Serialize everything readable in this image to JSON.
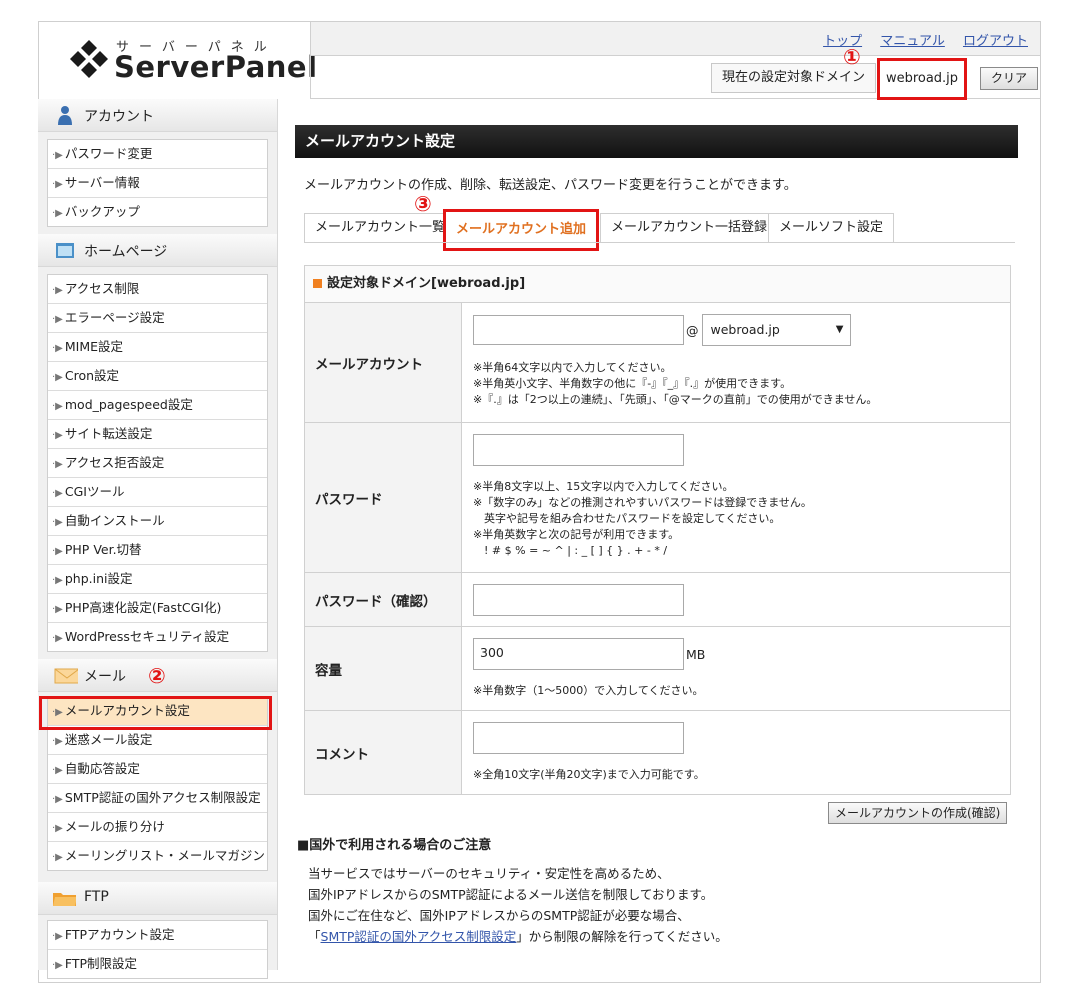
{
  "header": {
    "logo_kana": "サーバーパネル",
    "logo_text": "ServerPanel",
    "links": [
      "トップ",
      "マニュアル",
      "ログアウト"
    ],
    "current_domain_label": "現在の設定対象ドメイン",
    "current_domain_value": "webroad.jp",
    "clear_label": "クリア"
  },
  "annotations": [
    "①",
    "②",
    "③"
  ],
  "sidebar": {
    "account": {
      "title": "アカウント",
      "items": [
        "パスワード変更",
        "サーバー情報",
        "バックアップ"
      ]
    },
    "homepage": {
      "title": "ホームページ",
      "items": [
        "アクセス制限",
        "エラーページ設定",
        "MIME設定",
        "Cron設定",
        "mod_pagespeed設定",
        "サイト転送設定",
        "アクセス拒否設定",
        "CGIツール",
        "自動インストール",
        "PHP Ver.切替",
        "php.ini設定",
        "PHP高速化設定(FastCGI化)",
        "WordPressセキュリティ設定"
      ]
    },
    "mail": {
      "title": "メール",
      "items": [
        "メールアカウント設定",
        "迷惑メール設定",
        "自動応答設定",
        "SMTP認証の国外アクセス制限設定",
        "メールの振り分け",
        "メーリングリスト・メールマガジン"
      ]
    },
    "ftp": {
      "title": "FTP",
      "items": [
        "FTPアカウント設定",
        "FTP制限設定"
      ]
    }
  },
  "main": {
    "title": "メールアカウント設定",
    "description": "メールアカウントの作成、削除、転送設定、パスワード変更を行うことができます。",
    "tabs": [
      "メールアカウント一覧",
      "メールアカウント追加",
      "メールアカウント一括登録",
      "メールソフト設定"
    ],
    "form": {
      "header": "設定対象ドメイン[webroad.jp]",
      "account": {
        "label": "メールアカウント",
        "at": "@",
        "domain_select": "webroad.jp",
        "notes": "※半角64文字以内で入力してください。\n※半角英小文字、半角数字の他に『-』『_』『.』が使用できます。\n※『.』は「2つ以上の連続」、「先頭」、「@マークの直前」での使用ができません。"
      },
      "password": {
        "label": "パスワード",
        "notes": "※半角8文字以上、15文字以内で入力してください。\n※「数字のみ」などの推測されやすいパスワードは登録できません。\n　英字や記号を組み合わせたパスワードを設定してください。\n※半角英数字と次の記号が利用できます。\n　! # $ % = ~ ^ | : _ [ ] { } . + - * /"
      },
      "password_confirm": {
        "label": "パスワード（確認）"
      },
      "capacity": {
        "label": "容量",
        "value": "300",
        "unit": "MB",
        "notes": "※半角数字（1～5000）で入力してください。"
      },
      "comment": {
        "label": "コメント",
        "notes": "※全角10文字(半角20文字)まで入力可能です。"
      }
    },
    "submit_label": "メールアカウントの作成(確認)",
    "caution_title": "■国外で利用される場合のご注意",
    "caution_lines": [
      "当サービスではサーバーのセキュリティ・安定性を高めるため、",
      "国外IPアドレスからのSMTP認証によるメール送信を制限しております。",
      "国外にご在住など、国外IPアドレスからのSMTP認証が必要な場合、"
    ],
    "caution_link_open": "「",
    "caution_link": "SMTP認証の国外アクセス制限設定",
    "caution_link_tail": "」から制限の解除を行ってください。"
  }
}
